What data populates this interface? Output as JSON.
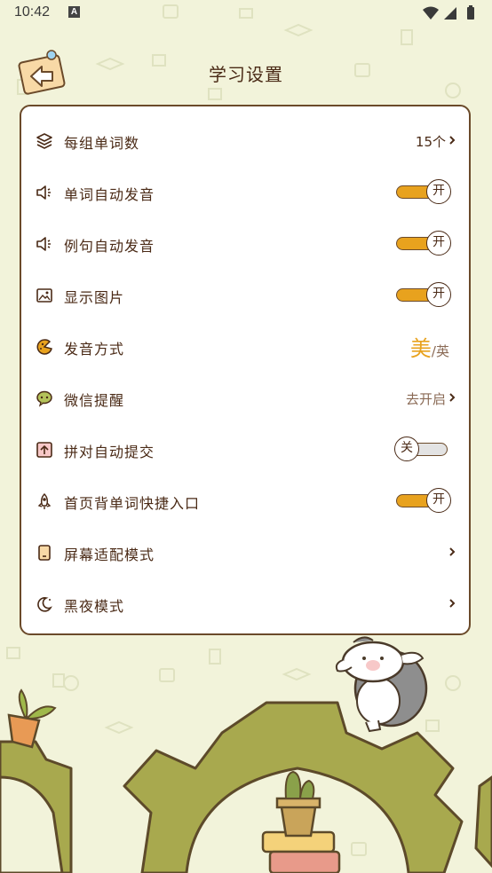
{
  "status": {
    "time": "10:42",
    "notification_letter": "A"
  },
  "header": {
    "title": "学习设置"
  },
  "settings": [
    {
      "label": "每组单词数",
      "icon": "layers-icon",
      "value": "15个"
    },
    {
      "label": "单词自动发音",
      "icon": "speaker-icon",
      "toggle": "开"
    },
    {
      "label": "例句自动发音",
      "icon": "speaker-icon",
      "toggle": "开"
    },
    {
      "label": "显示图片",
      "icon": "image-icon",
      "toggle": "开"
    },
    {
      "label": "发音方式",
      "icon": "pronunciation-icon",
      "accent_primary": "美",
      "accent_secondary": "英"
    },
    {
      "label": "微信提醒",
      "icon": "wechat-icon",
      "value": "去开启"
    },
    {
      "label": "拼对自动提交",
      "icon": "upload-icon",
      "toggle": "关"
    },
    {
      "label": "首页背单词快捷入口",
      "icon": "rocket-icon",
      "toggle": "开"
    },
    {
      "label": "屏幕适配模式",
      "icon": "tablet-icon"
    },
    {
      "label": "黑夜模式",
      "icon": "moon-icon"
    }
  ],
  "colors": {
    "accent": "#e8a21e",
    "background": "#f2f3da",
    "text": "#4a2a16",
    "gear": "#a8a94e"
  }
}
